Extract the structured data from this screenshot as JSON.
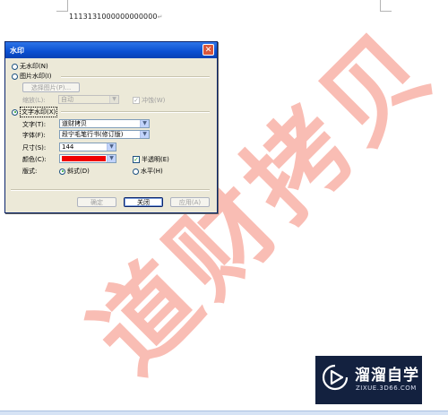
{
  "document": {
    "text": "1113131000000000000",
    "paragraph_mark": "↵"
  },
  "watermark": {
    "text": "道财拷贝",
    "color": "#f7a89c"
  },
  "dialog": {
    "title": "水印",
    "close_glyph": "✕",
    "no_watermark": "无水印(N)",
    "picture_watermark": "图片水印(I)",
    "select_picture": "选择图片(P)...",
    "scale_label": "缩放(L):",
    "scale_value": "自动",
    "washout": "冲蚀(W)",
    "text_watermark": "文字水印(X)",
    "text_label": "文字(T):",
    "text_value": "道财拷贝",
    "font_label": "字体(F):",
    "font_value": "段宁毛笔行书(修订版)",
    "size_label": "尺寸(S):",
    "size_value": "144",
    "color_label": "颜色(C):",
    "color_value": "#f00000",
    "semitransparent": "半透明(E)",
    "layout_label": "版式:",
    "diagonal": "斜式(D)",
    "horizontal": "水平(H)",
    "ok": "确定",
    "close": "关闭",
    "apply": "应用(A)"
  },
  "logo": {
    "title": "溜溜自学",
    "subtitle": "ZIXUE.3D66.COM"
  }
}
